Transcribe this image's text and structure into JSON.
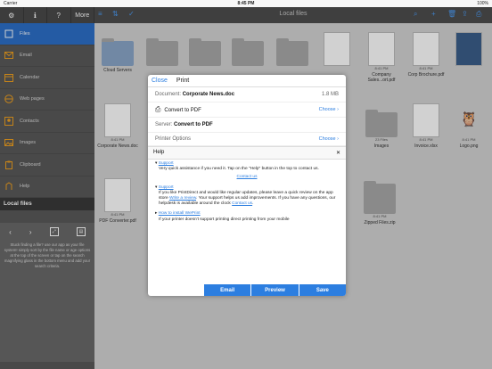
{
  "status": {
    "carrier": "Carrier",
    "time": "8:45 PM",
    "battery": "100%"
  },
  "sidebar": {
    "top_more": "More",
    "items": [
      {
        "label": "Files",
        "icon": "files-icon"
      },
      {
        "label": "Email",
        "icon": "mail-icon"
      },
      {
        "label": "Calendar",
        "icon": "calendar-icon"
      },
      {
        "label": "Web pages",
        "icon": "web-icon"
      },
      {
        "label": "Contacts",
        "icon": "contacts-icon"
      },
      {
        "label": "Images",
        "icon": "images-icon"
      },
      {
        "label": "Clipboard",
        "icon": "clipboard-icon"
      },
      {
        "label": "Help",
        "icon": "help-icon"
      }
    ],
    "section_title": "Local files",
    "help_text": "Stuck finding a file? use our app as your file system! simply sort by the file name or age options at the top of the screen or tap on the search magnifying glass in the bottom menu and add your search criteria."
  },
  "main": {
    "title": "Local files",
    "tiles": [
      {
        "label": "Cloud Servers",
        "meta": ""
      },
      {
        "label": "Company Sales...ort.pdf",
        "meta": "8:41 PM"
      },
      {
        "label": "Corp Brochure.pdf",
        "meta": "8:41 PM"
      },
      {
        "label": "Corporate News.doc",
        "meta": "8:41 PM"
      },
      {
        "label": "Images",
        "meta": "23 Files"
      },
      {
        "label": "Invoice.xlsx",
        "meta": "8:41 PM"
      },
      {
        "label": "Logo.png",
        "meta": "8:41 PM"
      },
      {
        "label": "PDF Converter.pdf",
        "meta": "8:41 PM"
      },
      {
        "label": "Zipped Files.zip",
        "meta": "8:41 PM"
      }
    ]
  },
  "dialog": {
    "close": "Close",
    "print": "Print",
    "document_label": "Document:",
    "document_value": "Corporate News.doc",
    "document_size": "1.8 MB",
    "printer_value": "Convert to PDF",
    "choose": "Choose",
    "server_label": "Server:",
    "server_value": "Convert to PDF",
    "printer_options": "Printer Options",
    "help_title": "Help",
    "support1_title": "Support",
    "support1_text": "Very quick assistance if you need it. Tap on the \"Help\" button in the top to contact us.",
    "contact_us": "Contact us",
    "support2_title": "Support",
    "support2_text_a": "If you like PrintDirect and would like regular updates, please leave a quick review on the app store ",
    "write_review": "Write a review",
    "support2_text_b": ". Your support helps us add improvements. If you have any questions, our helpdesk is available around the clock ",
    "contact_us2": "Contact us",
    "install_title": "How to install WePrint",
    "install_text": "If your printer doesn't support printing direct printing from your mobile",
    "btn_email": "Email",
    "btn_preview": "Preview",
    "btn_save": "Save"
  }
}
